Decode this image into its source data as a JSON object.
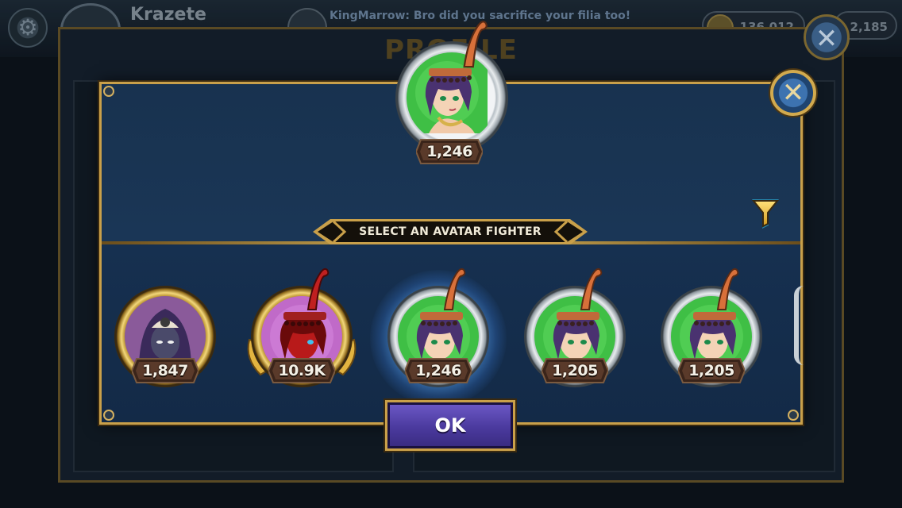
{
  "background": {
    "player_name": "Krazete",
    "chat_message": "KingMarrow: Bro did you sacrifice your filia too!",
    "currency_1": "136,012",
    "currency_2": "2,185"
  },
  "profile": {
    "title": "PROFILE"
  },
  "selector": {
    "selected": {
      "fighter": "Eliza",
      "score": "1,246"
    },
    "banner": "SELECT AN AVATAR FIGHTER",
    "avatars": [
      {
        "fighter": "Annie-dark",
        "score": "1,847",
        "ring": "gold",
        "selected": false
      },
      {
        "fighter": "Eliza-red",
        "score": "10.9K",
        "ring": "gold",
        "selected": false
      },
      {
        "fighter": "Eliza",
        "score": "1,246",
        "ring": "silver",
        "selected": true
      },
      {
        "fighter": "Eliza",
        "score": "1,205",
        "ring": "silver",
        "selected": false
      },
      {
        "fighter": "Eliza",
        "score": "1,205",
        "ring": "silver",
        "selected": false
      }
    ],
    "ok_label": "OK"
  },
  "icons": {
    "close": "close-icon",
    "filter": "filter-icon",
    "settings": "gear-icon"
  },
  "colors": {
    "gold_trim": "#c9a04a",
    "dialog_blue": "#1a3656",
    "ok_purple": "#5a48b4",
    "filter_cyan": "#2fc4f0"
  }
}
